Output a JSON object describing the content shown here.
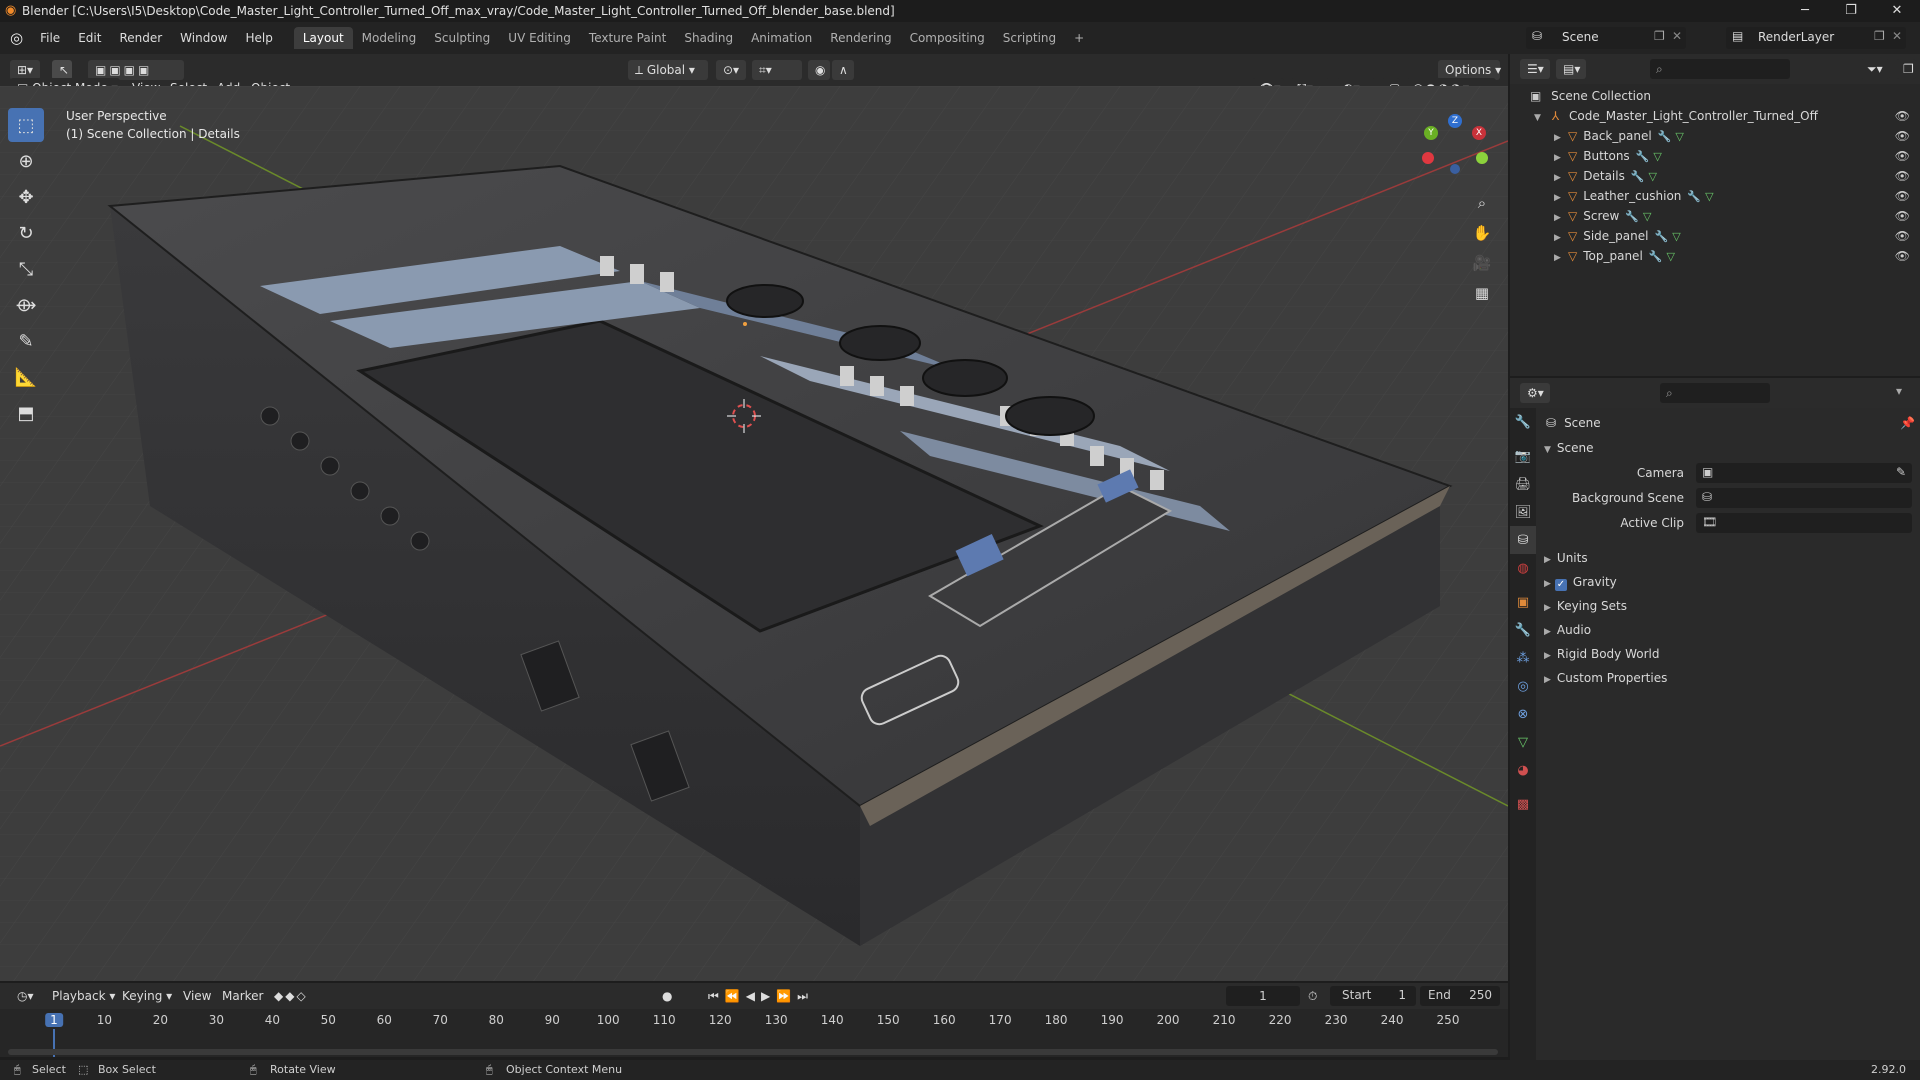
{
  "title": "Blender [C:\\Users\\I5\\Desktop\\Code_Master_Light_Controller_Turned_Off_max_vray/Code_Master_Light_Controller_Turned_Off_blender_base.blend]",
  "menu": [
    "File",
    "Edit",
    "Render",
    "Window",
    "Help"
  ],
  "workspaces": [
    "Layout",
    "Modeling",
    "Sculpting",
    "UV Editing",
    "Texture Paint",
    "Shading",
    "Animation",
    "Rendering",
    "Compositing",
    "Scripting"
  ],
  "active_workspace": "Layout",
  "scene_field": "Scene",
  "renderlayer_field": "RenderLayer",
  "viewport": {
    "mode": "Object Mode",
    "menus": [
      "View",
      "Select",
      "Add",
      "Object"
    ],
    "transform": "Global",
    "options": "Options",
    "info_line1": "User Perspective",
    "info_line2": "(1) Scene Collection | Details",
    "gizmo": {
      "x": "X",
      "y": "Y",
      "z": "Z"
    }
  },
  "outliner": {
    "root": "Scene Collection",
    "collection": "Code_Master_Light_Controller_Turned_Off",
    "items": [
      "Back_panel",
      "Buttons",
      "Details",
      "Leather_cushion",
      "Screw",
      "Side_panel",
      "Top_panel"
    ]
  },
  "properties": {
    "header": "Scene",
    "panel": "Scene",
    "camera_label": "Camera",
    "bg_scene_label": "Background Scene",
    "active_clip_label": "Active Clip",
    "sections": [
      "Units",
      "Gravity",
      "Keying Sets",
      "Audio",
      "Rigid Body World",
      "Custom Properties"
    ],
    "gravity_checked": true
  },
  "timeline": {
    "menus": [
      "Playback",
      "Keying",
      "View",
      "Marker"
    ],
    "current_frame": "1",
    "start_label": "Start",
    "start": "1",
    "end_label": "End",
    "end": "250",
    "ticks": [
      "1",
      "10",
      "20",
      "30",
      "40",
      "50",
      "60",
      "70",
      "80",
      "90",
      "100",
      "110",
      "120",
      "130",
      "140",
      "150",
      "160",
      "170",
      "180",
      "190",
      "200",
      "210",
      "220",
      "230",
      "240",
      "250"
    ]
  },
  "status": {
    "select": "Select",
    "box_select": "Box Select",
    "rotate": "Rotate View",
    "context": "Object Context Menu",
    "version": "2.92.0"
  },
  "colors": {
    "accent": "#4772b3",
    "object": "#e08a3a"
  }
}
